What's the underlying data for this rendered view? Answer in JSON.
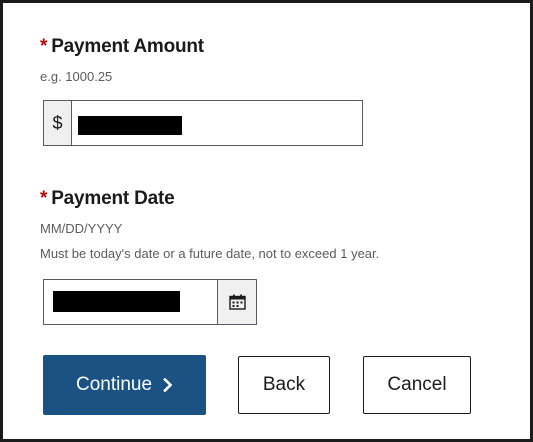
{
  "amount_field": {
    "required_marker": "*",
    "label": "Payment Amount",
    "hint": "e.g. 1000.25",
    "prefix": "$",
    "value": ""
  },
  "date_field": {
    "required_marker": "*",
    "label": "Payment Date",
    "format_hint": "MM/DD/YYYY",
    "rule_hint": "Must be today's date or a future date, not to exceed 1 year.",
    "value": "",
    "calendar_icon": "calendar-icon"
  },
  "actions": {
    "continue_label": "Continue",
    "continue_icon": "chevron-right-icon",
    "back_label": "Back",
    "cancel_label": "Cancel"
  },
  "colors": {
    "primary": "#1a5383",
    "required": "#b50909",
    "redaction": "#000000"
  }
}
